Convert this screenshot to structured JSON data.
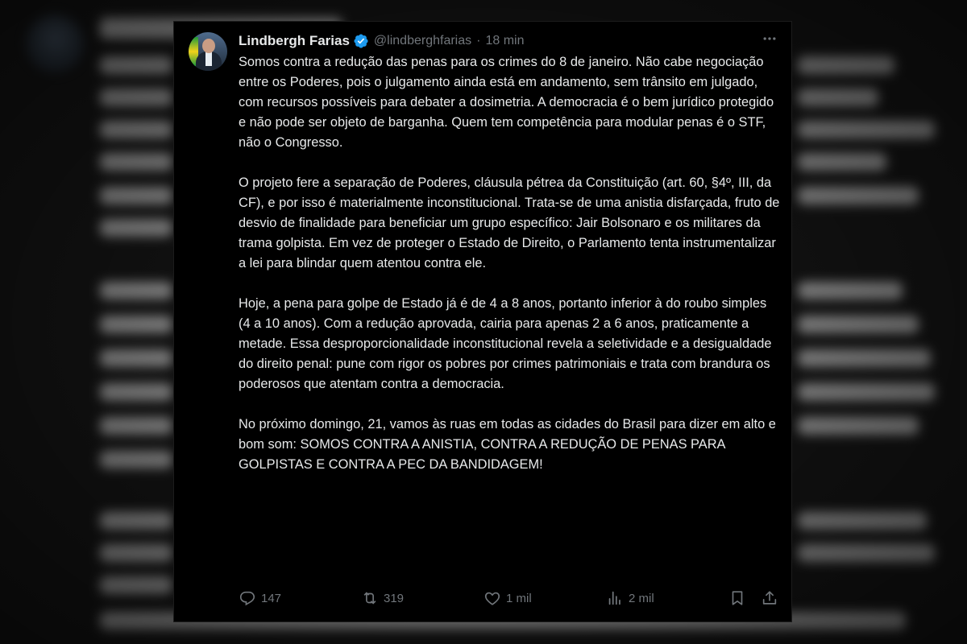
{
  "tweet": {
    "author_name": "Lindbergh Farias",
    "handle": "@lindberghfarias",
    "separator": "·",
    "time": "18 min",
    "paragraphs": [
      "Somos contra a redução das penas para os crimes do 8 de janeiro. Não cabe negociação entre os Poderes, pois o julgamento ainda está em andamento, sem trânsito em julgado, com recursos possíveis para debater a dosimetria. A democracia é o bem jurídico protegido e não pode ser objeto de barganha. Quem tem competência para modular penas é o STF, não o Congresso.",
      "O projeto fere a separação de Poderes, cláusula pétrea da Constituição (art. 60, §4º, III, da CF), e por isso é materialmente inconstitucional. Trata-se de uma anistia disfarçada, fruto de desvio de finalidade para beneficiar um grupo específico: Jair Bolsonaro e os militares da trama golpista. Em vez de proteger o Estado de Direito, o Parlamento tenta instrumentalizar a lei para blindar quem atentou contra ele.",
      "Hoje, a pena para golpe de Estado já é de 4 a 8 anos, portanto inferior à do roubo simples (4 a 10 anos). Com a redução aprovada, cairia para apenas 2 a 6 anos, praticamente a metade. Essa desproporcionalidade inconstitucional revela a seletividade e a desigualdade do direito penal: pune com rigor os pobres por crimes patrimoniais e trata com brandura os poderosos que atentam contra a democracia.",
      "No próximo domingo, 21, vamos às ruas em todas as cidades do Brasil para dizer em alto e bom som: SOMOS CONTRA A ANISTIA, CONTRA A REDUÇÃO DE PENAS PARA GOLPISTAS E CONTRA A PEC DA BANDIDAGEM!"
    ],
    "metrics": {
      "replies": "147",
      "reposts": "319",
      "likes": "1 mil",
      "views": "2 mil"
    }
  },
  "icons": {
    "verified": "verified-badge-icon",
    "more": "more-options-icon",
    "reply": "reply-icon",
    "repost": "repost-icon",
    "like": "heart-icon",
    "views": "views-chart-icon",
    "bookmark": "bookmark-icon",
    "share": "share-icon"
  },
  "colors": {
    "background": "#000000",
    "text": "#e7e9ea",
    "muted": "#71767b",
    "verified": "#1d9bf0"
  }
}
